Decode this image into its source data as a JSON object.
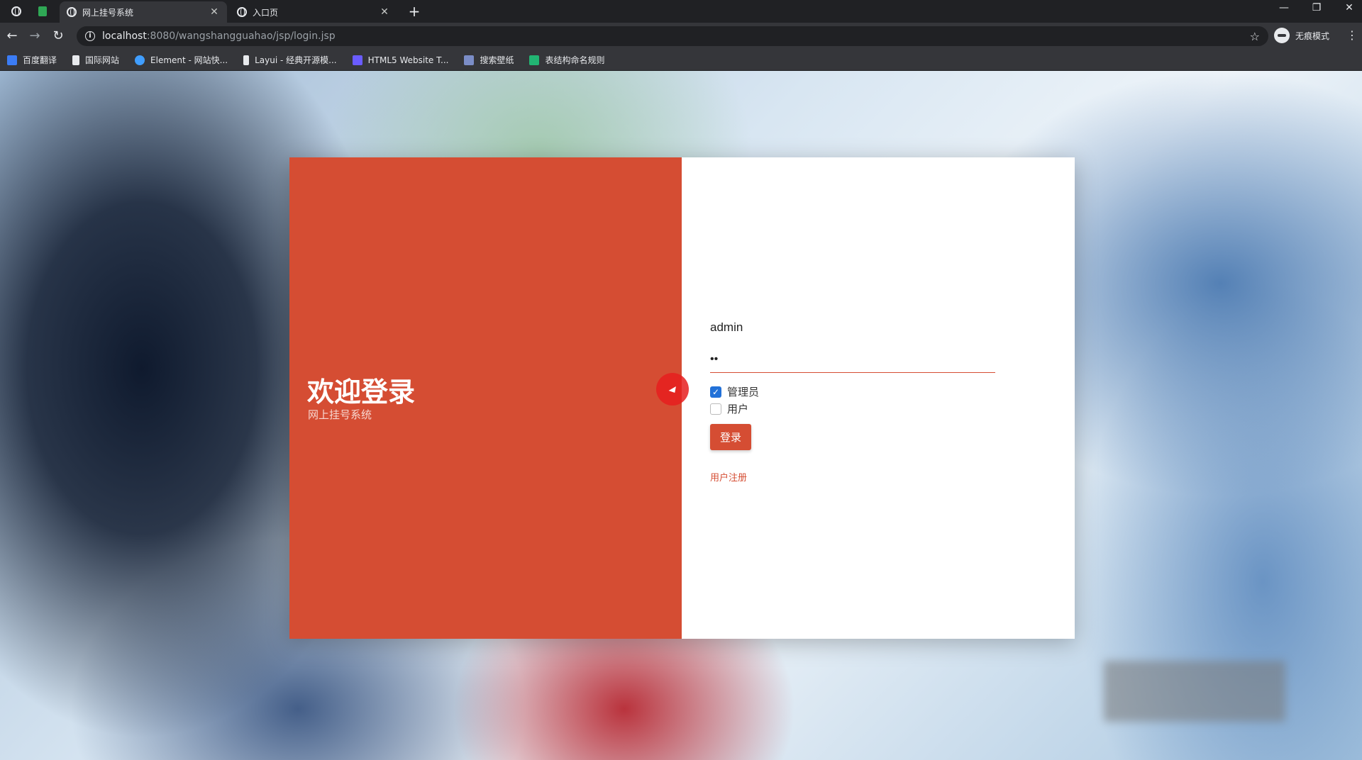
{
  "browser": {
    "tabs": [
      {
        "title": "网上挂号系统",
        "active": true
      },
      {
        "title": "入口页",
        "active": false
      }
    ],
    "url_host": "localhost",
    "url_rest": ":8080/wangshangguahao/jsp/login.jsp",
    "profile_label": "无痕模式",
    "bookmarks": [
      {
        "label": "百度翻译",
        "icon_color": "#3b7cf5"
      },
      {
        "label": "国际网站",
        "icon_color": "#e8eaed"
      },
      {
        "label": "Element - 网站快...",
        "icon_color": "#409eff"
      },
      {
        "label": "Layui - 经典开源模...",
        "icon_color": "#e8eaed"
      },
      {
        "label": "HTML5 Website T...",
        "icon_color": "#6a5cff"
      },
      {
        "label": "搜索壁纸",
        "icon_color": "#7b8dc7"
      },
      {
        "label": "表结构命名规则",
        "icon_color": "#22b573"
      }
    ]
  },
  "login": {
    "title": "欢迎登录",
    "subtitle": "网上挂号系统",
    "username_value": "admin",
    "password_value": "12",
    "roles": [
      {
        "label": "管理员",
        "checked": true
      },
      {
        "label": "用户",
        "checked": false
      }
    ],
    "submit_label": "登录",
    "register_label": "用户注册"
  },
  "colors": {
    "brand": "#d54d33",
    "checkbox_accent": "#2271d8"
  }
}
